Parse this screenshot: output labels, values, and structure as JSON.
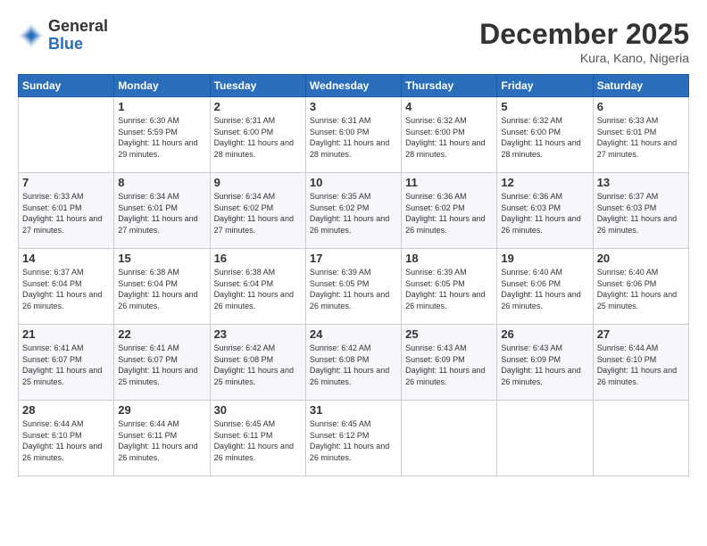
{
  "logo": {
    "general": "General",
    "blue": "Blue"
  },
  "title": "December 2025",
  "location": "Kura, Kano, Nigeria",
  "days_header": [
    "Sunday",
    "Monday",
    "Tuesday",
    "Wednesday",
    "Thursday",
    "Friday",
    "Saturday"
  ],
  "weeks": [
    [
      {
        "day": "",
        "sunrise": "",
        "sunset": "",
        "daylight": ""
      },
      {
        "day": "1",
        "sunrise": "Sunrise: 6:30 AM",
        "sunset": "Sunset: 5:59 PM",
        "daylight": "Daylight: 11 hours and 29 minutes."
      },
      {
        "day": "2",
        "sunrise": "Sunrise: 6:31 AM",
        "sunset": "Sunset: 6:00 PM",
        "daylight": "Daylight: 11 hours and 28 minutes."
      },
      {
        "day": "3",
        "sunrise": "Sunrise: 6:31 AM",
        "sunset": "Sunset: 6:00 PM",
        "daylight": "Daylight: 11 hours and 28 minutes."
      },
      {
        "day": "4",
        "sunrise": "Sunrise: 6:32 AM",
        "sunset": "Sunset: 6:00 PM",
        "daylight": "Daylight: 11 hours and 28 minutes."
      },
      {
        "day": "5",
        "sunrise": "Sunrise: 6:32 AM",
        "sunset": "Sunset: 6:00 PM",
        "daylight": "Daylight: 11 hours and 28 minutes."
      },
      {
        "day": "6",
        "sunrise": "Sunrise: 6:33 AM",
        "sunset": "Sunset: 6:01 PM",
        "daylight": "Daylight: 11 hours and 27 minutes."
      }
    ],
    [
      {
        "day": "7",
        "sunrise": "Sunrise: 6:33 AM",
        "sunset": "Sunset: 6:01 PM",
        "daylight": "Daylight: 11 hours and 27 minutes."
      },
      {
        "day": "8",
        "sunrise": "Sunrise: 6:34 AM",
        "sunset": "Sunset: 6:01 PM",
        "daylight": "Daylight: 11 hours and 27 minutes."
      },
      {
        "day": "9",
        "sunrise": "Sunrise: 6:34 AM",
        "sunset": "Sunset: 6:02 PM",
        "daylight": "Daylight: 11 hours and 27 minutes."
      },
      {
        "day": "10",
        "sunrise": "Sunrise: 6:35 AM",
        "sunset": "Sunset: 6:02 PM",
        "daylight": "Daylight: 11 hours and 26 minutes."
      },
      {
        "day": "11",
        "sunrise": "Sunrise: 6:36 AM",
        "sunset": "Sunset: 6:02 PM",
        "daylight": "Daylight: 11 hours and 26 minutes."
      },
      {
        "day": "12",
        "sunrise": "Sunrise: 6:36 AM",
        "sunset": "Sunset: 6:03 PM",
        "daylight": "Daylight: 11 hours and 26 minutes."
      },
      {
        "day": "13",
        "sunrise": "Sunrise: 6:37 AM",
        "sunset": "Sunset: 6:03 PM",
        "daylight": "Daylight: 11 hours and 26 minutes."
      }
    ],
    [
      {
        "day": "14",
        "sunrise": "Sunrise: 6:37 AM",
        "sunset": "Sunset: 6:04 PM",
        "daylight": "Daylight: 11 hours and 26 minutes."
      },
      {
        "day": "15",
        "sunrise": "Sunrise: 6:38 AM",
        "sunset": "Sunset: 6:04 PM",
        "daylight": "Daylight: 11 hours and 26 minutes."
      },
      {
        "day": "16",
        "sunrise": "Sunrise: 6:38 AM",
        "sunset": "Sunset: 6:04 PM",
        "daylight": "Daylight: 11 hours and 26 minutes."
      },
      {
        "day": "17",
        "sunrise": "Sunrise: 6:39 AM",
        "sunset": "Sunset: 6:05 PM",
        "daylight": "Daylight: 11 hours and 26 minutes."
      },
      {
        "day": "18",
        "sunrise": "Sunrise: 6:39 AM",
        "sunset": "Sunset: 6:05 PM",
        "daylight": "Daylight: 11 hours and 26 minutes."
      },
      {
        "day": "19",
        "sunrise": "Sunrise: 6:40 AM",
        "sunset": "Sunset: 6:06 PM",
        "daylight": "Daylight: 11 hours and 26 minutes."
      },
      {
        "day": "20",
        "sunrise": "Sunrise: 6:40 AM",
        "sunset": "Sunset: 6:06 PM",
        "daylight": "Daylight: 11 hours and 25 minutes."
      }
    ],
    [
      {
        "day": "21",
        "sunrise": "Sunrise: 6:41 AM",
        "sunset": "Sunset: 6:07 PM",
        "daylight": "Daylight: 11 hours and 25 minutes."
      },
      {
        "day": "22",
        "sunrise": "Sunrise: 6:41 AM",
        "sunset": "Sunset: 6:07 PM",
        "daylight": "Daylight: 11 hours and 25 minutes."
      },
      {
        "day": "23",
        "sunrise": "Sunrise: 6:42 AM",
        "sunset": "Sunset: 6:08 PM",
        "daylight": "Daylight: 11 hours and 25 minutes."
      },
      {
        "day": "24",
        "sunrise": "Sunrise: 6:42 AM",
        "sunset": "Sunset: 6:08 PM",
        "daylight": "Daylight: 11 hours and 26 minutes."
      },
      {
        "day": "25",
        "sunrise": "Sunrise: 6:43 AM",
        "sunset": "Sunset: 6:09 PM",
        "daylight": "Daylight: 11 hours and 26 minutes."
      },
      {
        "day": "26",
        "sunrise": "Sunrise: 6:43 AM",
        "sunset": "Sunset: 6:09 PM",
        "daylight": "Daylight: 11 hours and 26 minutes."
      },
      {
        "day": "27",
        "sunrise": "Sunrise: 6:44 AM",
        "sunset": "Sunset: 6:10 PM",
        "daylight": "Daylight: 11 hours and 26 minutes."
      }
    ],
    [
      {
        "day": "28",
        "sunrise": "Sunrise: 6:44 AM",
        "sunset": "Sunset: 6:10 PM",
        "daylight": "Daylight: 11 hours and 26 minutes."
      },
      {
        "day": "29",
        "sunrise": "Sunrise: 6:44 AM",
        "sunset": "Sunset: 6:11 PM",
        "daylight": "Daylight: 11 hours and 26 minutes."
      },
      {
        "day": "30",
        "sunrise": "Sunrise: 6:45 AM",
        "sunset": "Sunset: 6:11 PM",
        "daylight": "Daylight: 11 hours and 26 minutes."
      },
      {
        "day": "31",
        "sunrise": "Sunrise: 6:45 AM",
        "sunset": "Sunset: 6:12 PM",
        "daylight": "Daylight: 11 hours and 26 minutes."
      },
      {
        "day": "",
        "sunrise": "",
        "sunset": "",
        "daylight": ""
      },
      {
        "day": "",
        "sunrise": "",
        "sunset": "",
        "daylight": ""
      },
      {
        "day": "",
        "sunrise": "",
        "sunset": "",
        "daylight": ""
      }
    ]
  ]
}
